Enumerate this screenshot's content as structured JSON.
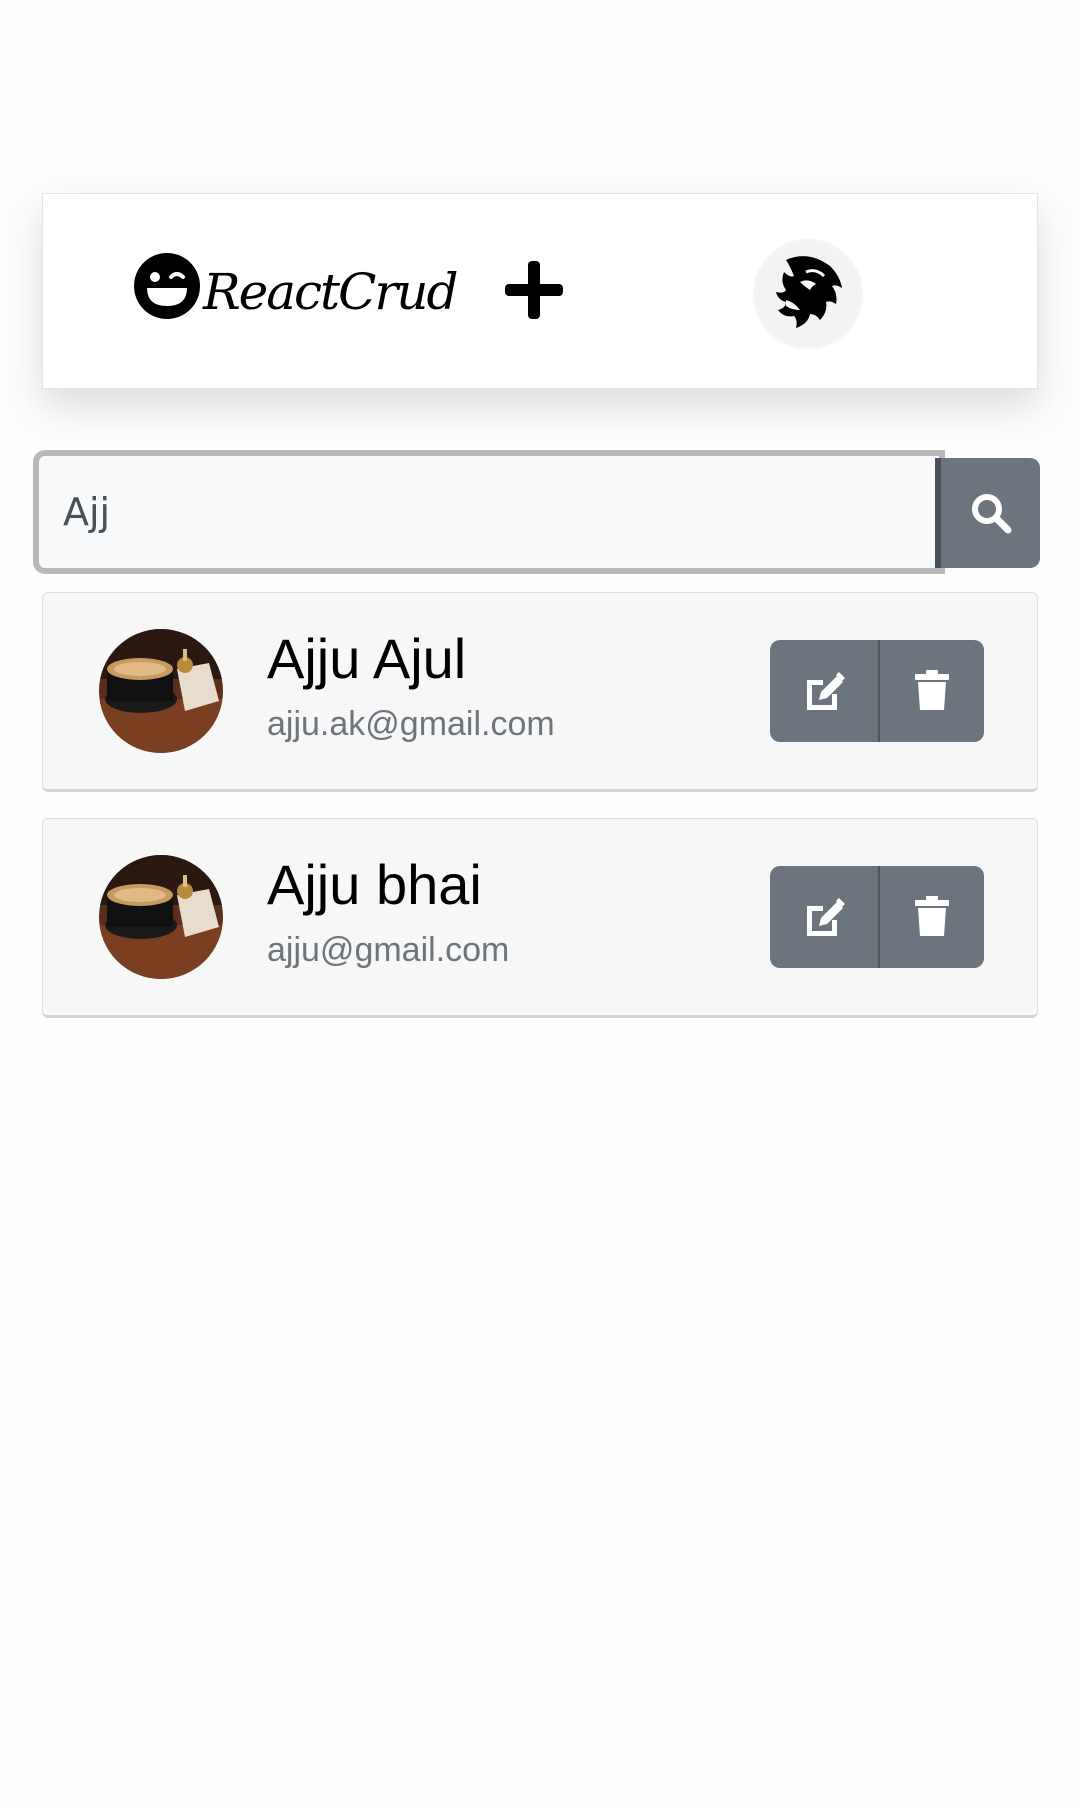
{
  "header": {
    "brand_text": "ReactCrud",
    "brand_icon": "grinning-face-icon",
    "add_icon": "plus-icon",
    "profile_icon": "lion-avatar-icon"
  },
  "search": {
    "value": "Ajj",
    "icon": "search-icon"
  },
  "contacts": [
    {
      "name": "Ajju Ajul",
      "email": "ajju.ak@gmail.com",
      "edit_icon": "edit-icon",
      "delete_icon": "trash-icon"
    },
    {
      "name": "Ajju bhai",
      "email": "ajju@gmail.com",
      "edit_icon": "edit-icon",
      "delete_icon": "trash-icon"
    }
  ],
  "colors": {
    "button": "#6c757d",
    "card_bg": "#f7f7f7",
    "email_text": "#6c757d"
  }
}
